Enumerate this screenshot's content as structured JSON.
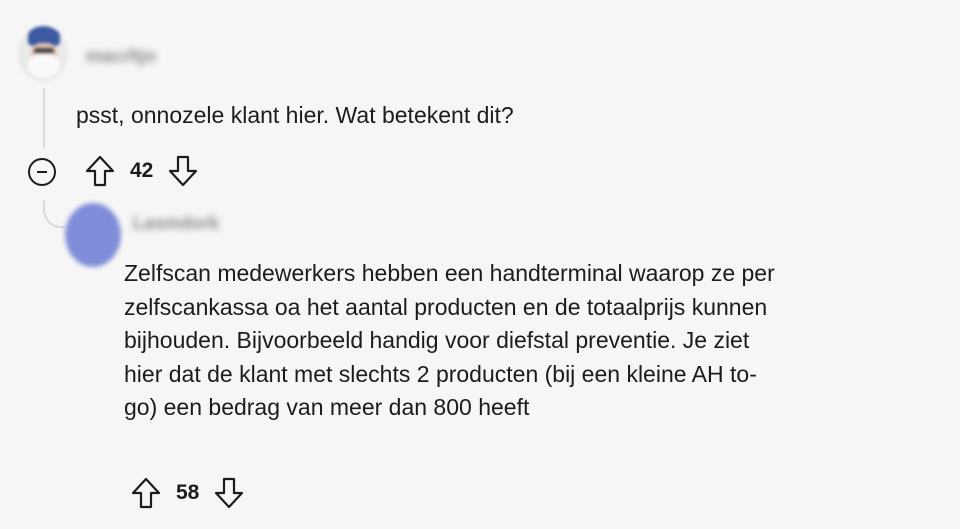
{
  "comment1": {
    "username": "macrltjo",
    "body": "psst, onnozele klant hier. Wat betekent dit?",
    "score": "42",
    "collapse_icon": "minus-circle-icon"
  },
  "comment2": {
    "username": "Lasmdork",
    "lines": [
      "Zelfscan medewerkers hebben een handterminal waarop ze per",
      "zelfscankassa oa het aantal producten en de totaalprijs kunnen",
      "bijhouden. Bijvoorbeeld handig voor diefstal preventie. Je ziet",
      "hier dat de klant met slechts 2 producten (bij een kleine AH to-",
      "go) een bedrag van meer dan 800 heeft"
    ],
    "score": "58"
  }
}
